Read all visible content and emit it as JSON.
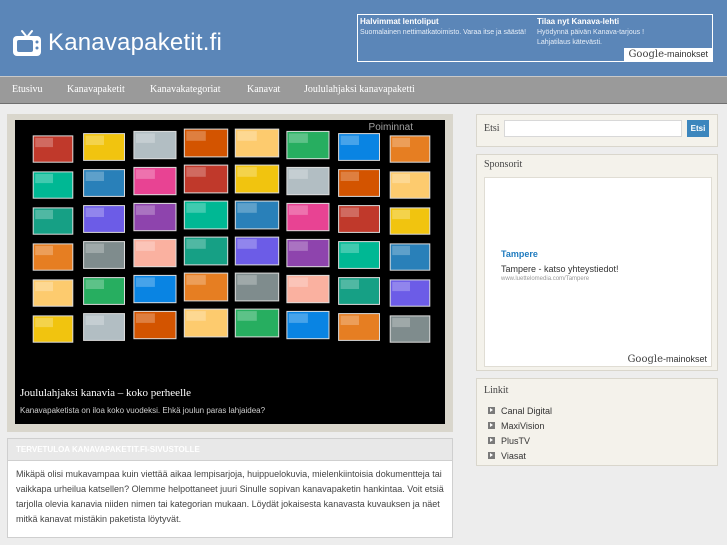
{
  "header": {
    "logo_text": "Kanavapaketit.fi",
    "logo_icon": "tv-icon",
    "ads": [
      {
        "title": "Halvimmat lentoliput",
        "text": "Suomalainen nettimatkatoimisto. Varaa itse ja säästä!"
      },
      {
        "title": "Tilaa nyt Kanava-lehti",
        "text": "Hyödynnä päivän Kanava-tarjous ! Lahjatilaus kätevästi."
      }
    ],
    "google_badge": {
      "brand": "Google",
      "label": "-mainokset"
    }
  },
  "nav": {
    "items": [
      "Etusivu",
      "Kanavapaketit",
      "Kanavakategoriat",
      "Kanavat",
      "Joululahjaksi kanavapaketti"
    ]
  },
  "slideshow": {
    "more_link": "Poiminnat",
    "caption_title": "Joululahjaksi kanavia – koko perheelle",
    "caption_text": "Kanavapaketista on iloa koko vuodeksi. Ehkä joulun paras lahjaidea?"
  },
  "welcome": {
    "title": "TERVETULOA KANAVAPAKETIT.FI-SIVUSTOLLE",
    "body": "Mikäpä olisi mukavampaa kuin viettää aikaa lempisarjoja, huippuelokuvia, mielenkiintoisia dokumentteja tai vaikkapa urheilua katsellen? Olemme helpottaneet juuri Sinulle sopivan kanavapaketin hankintaa. Voit etsiä tarjolla olevia kanavia niiden nimen tai kategorian mukaan. Löydät jokaisesta kanavasta kuvauksen ja näet mitkä kanavat mistäkin paketista löytyvät."
  },
  "sidebar": {
    "search": {
      "label": "Etsi",
      "placeholder": "",
      "button": "Etsi"
    },
    "sponsors": {
      "title": "Sponsorit",
      "ad_link": "Tampere",
      "ad_text": "Tampere - katso yhteystiedot!",
      "ad_url": "www.luettelomedia.com/Tampere",
      "google_badge": {
        "brand": "Google",
        "label": "-mainokset"
      }
    },
    "links": {
      "title": "Linkit",
      "items": [
        "Canal Digital",
        "MaxiVision",
        "PlusTV",
        "Viasat"
      ]
    }
  },
  "colors": {
    "header_bg": "#5b86b8",
    "nav_bg": "#9a9a9a",
    "accent": "#3c86bd",
    "sponsor_link": "#1f7bbf"
  }
}
